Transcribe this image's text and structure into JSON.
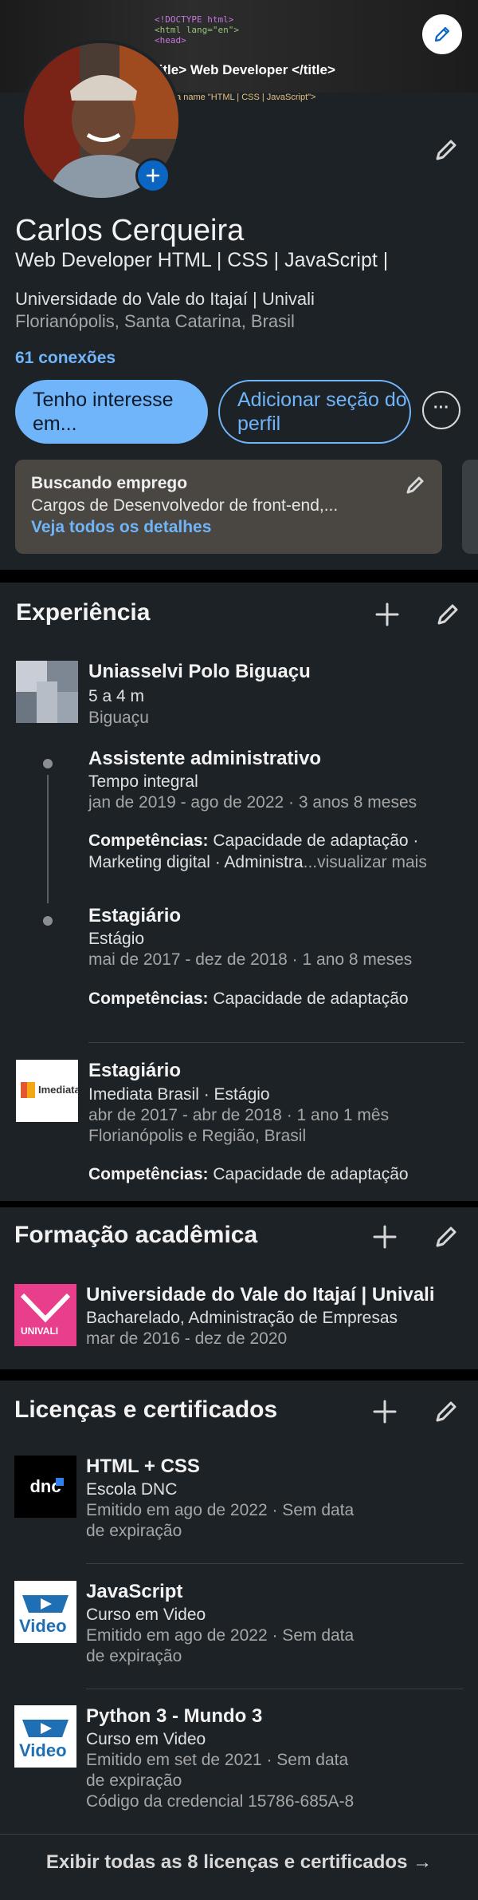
{
  "banner": {
    "code_lines": [
      "<!DOCTYPE html>",
      "<html lang=\"en\">",
      "<head>"
    ],
    "title_line": "title> Web Developer </title>",
    "meta_line": "ta name \"HTML | CSS | JavaScript\">"
  },
  "profile": {
    "name": "Carlos Cerqueira",
    "headline": "Web Developer HTML | CSS | JavaScript |",
    "education": "Universidade do Vale do Itajaí | Univali",
    "location": "Florianópolis, Santa Catarina, Brasil",
    "connections": "61 conexões",
    "btn_interest": "Tenho interesse em...",
    "btn_add_section": "Adicionar seção do perfil",
    "btn_more": "···"
  },
  "open_to_work": {
    "title": "Buscando emprego",
    "desc": "Cargos de Desenvolvedor de front-end,...",
    "link": "Veja todos os detalhes"
  },
  "experience": {
    "title": "Experiência",
    "company1": {
      "name": "Uniasselvi Polo Biguaçu",
      "duration": "5 a 4 m",
      "location": "Biguaçu",
      "roles": [
        {
          "title": "Assistente administrativo",
          "type": "Tempo integral",
          "dates": "jan de 2019 - ago de 2022 · 3 anos 8 meses",
          "skills_label": "Competências:",
          "skills_line1": " Capacidade de adaptação ·",
          "skills_line2": "Marketing digital · Administra",
          "skills_more": "...visualizar mais"
        },
        {
          "title": "Estagiário",
          "type": "Estágio",
          "dates": "mai de 2017 - dez de 2018 · 1 ano 8 meses",
          "skills_label": "Competências:",
          "skills_line1": " Capacidade de adaptação"
        }
      ]
    },
    "company2": {
      "role": "Estagiário",
      "company": "Imediata Brasil · Estágio",
      "dates": "abr de 2017 - abr de 2018 · 1 ano 1 mês",
      "location": "Florianópolis e Região, Brasil",
      "skills_label": "Competências:",
      "skills_line1": " Capacidade de adaptação",
      "logo_text": "Imediata"
    }
  },
  "education": {
    "title": "Formação acadêmica",
    "school": "Universidade do Vale do Itajaí | Univali",
    "degree": "Bacharelado, Administração de Empresas",
    "dates": "mar de 2016 - dez de 2020",
    "logo_text": "UNIVALI"
  },
  "licenses": {
    "title": "Licenças e certificados",
    "items": [
      {
        "name": "HTML + CSS",
        "issuer": "Escola DNC",
        "issued": "Emitido em ago de 2022 · Sem data",
        "issued2": "de expiração",
        "logo": "dnc"
      },
      {
        "name": "JavaScript",
        "issuer": "Curso em Video",
        "issued": "Emitido em ago de 2022 · Sem data",
        "issued2": "de expiração",
        "logo": "Video"
      },
      {
        "name": "Python 3 - Mundo 3",
        "issuer": "Curso em Video",
        "issued": "Emitido em set de 2021 · Sem data",
        "issued2": "de expiração",
        "credential": "Código da credencial 15786-685A-8",
        "logo": "Video"
      }
    ],
    "show_all": "Exibir todas as 8 licenças e certificados →"
  },
  "colors": {
    "bg": "#1d2226",
    "accent": "#70b5f9",
    "pill": "#70b5f9"
  }
}
